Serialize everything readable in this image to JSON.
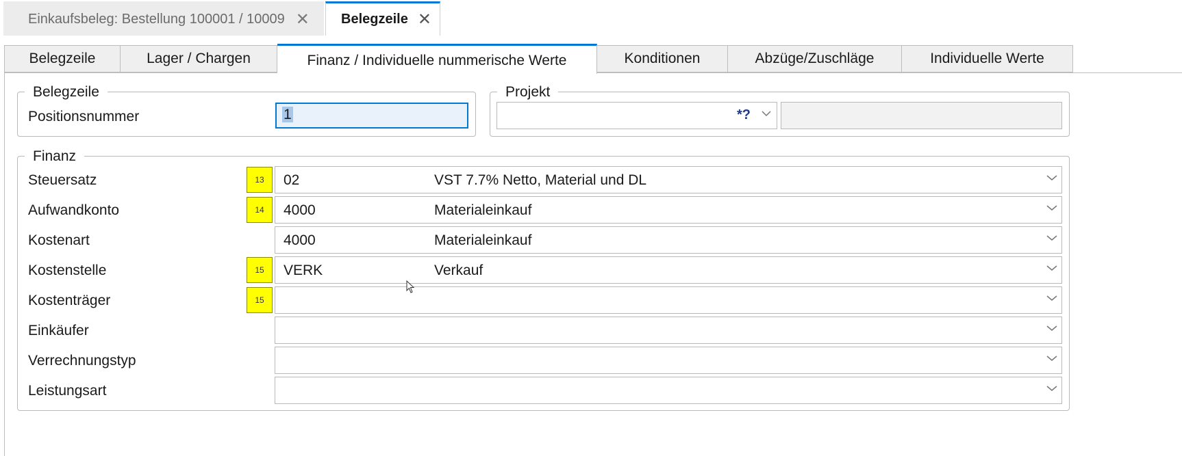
{
  "window_tabs": [
    {
      "label": "Einkaufsbeleg: Bestellung 100001 / 10009",
      "close": "✕"
    },
    {
      "label": "Belegzeile",
      "close": "✕"
    }
  ],
  "page_tabs": [
    "Belegzeile",
    "Lager / Chargen",
    "Finanz / Individuelle nummerische Werte",
    "Konditionen",
    "Abzüge/Zuschläge",
    "Individuelle Werte"
  ],
  "belegzeile_group": {
    "title": "Belegzeile",
    "positionsnummer_label": "Positionsnummer",
    "positionsnummer_value": "1"
  },
  "projekt_group": {
    "title": "Projekt",
    "lookup_glyph": "*?",
    "value": "",
    "description": ""
  },
  "finanz_group": {
    "title": "Finanz",
    "rows": [
      {
        "label": "Steuersatz",
        "badge": "13",
        "code": "02",
        "description": "VST 7.7% Netto, Material und DL"
      },
      {
        "label": "Aufwandkonto",
        "badge": "14",
        "code": "4000",
        "description": "Materialeinkauf"
      },
      {
        "label": "Kostenart",
        "badge": "",
        "code": "4000",
        "description": "Materialeinkauf"
      },
      {
        "label": "Kostenstelle",
        "badge": "15",
        "code": "VERK",
        "description": "Verkauf"
      },
      {
        "label": "Kostenträger",
        "badge": "15",
        "code": "",
        "description": ""
      },
      {
        "label": "Einkäufer",
        "badge": "",
        "code": "",
        "description": ""
      },
      {
        "label": "Verrechnungstyp",
        "badge": "",
        "code": "",
        "description": ""
      },
      {
        "label": "Leistungsart",
        "badge": "",
        "code": "",
        "description": ""
      }
    ]
  },
  "colors": {
    "accent": "#0078d4",
    "badge": "#ffff00"
  }
}
